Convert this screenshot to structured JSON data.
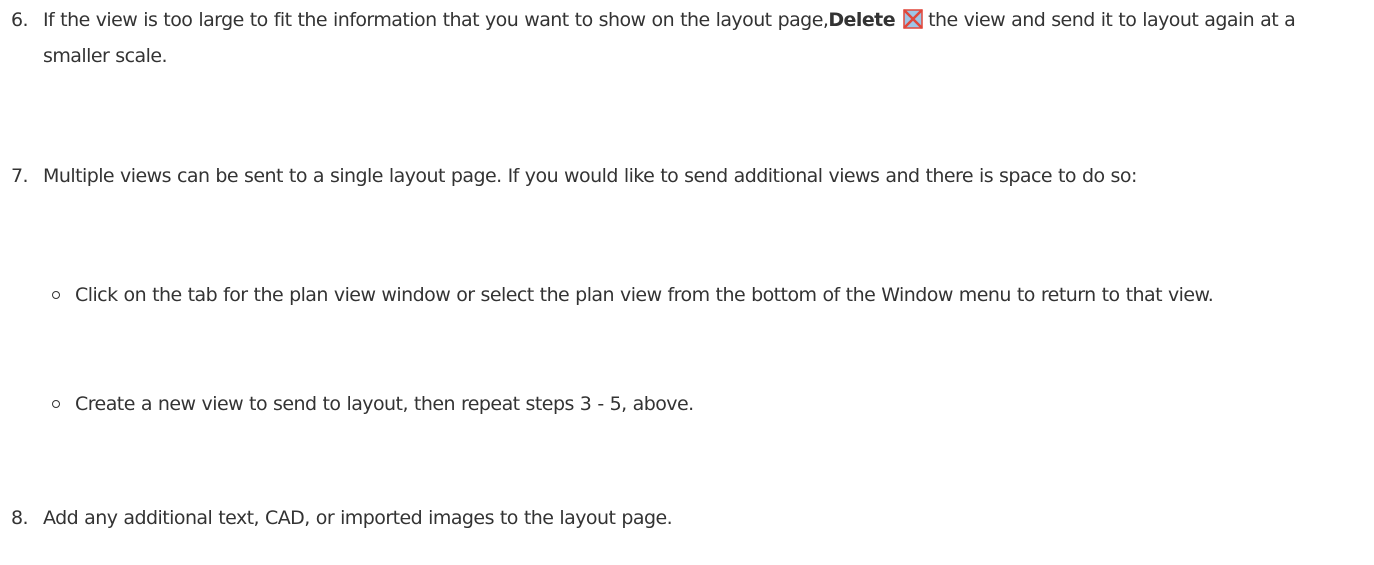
{
  "steps": [
    {
      "number": "6.",
      "text_before": "If the view is too large to fit the information that you want to show on the layout page,",
      "bold_text": "Delete",
      "icon": "delete-view-icon",
      "text_after": "the view and send it to layout again at a smaller scale."
    },
    {
      "number": "7.",
      "text": "Multiple views can be sent to a single layout page. If you would like to send additional views and there is space to do so:",
      "sub_items": [
        {
          "text": "Click on the tab for the plan view window or select the plan view from the bottom of the Window menu to return to that view."
        },
        {
          "text": "Create a new view to send to layout, then repeat steps 3 - 5, above."
        }
      ]
    },
    {
      "number": "8.",
      "text": "Add any additional text, CAD, or imported images to the layout page."
    }
  ],
  "colors": {
    "text": "#333333",
    "icon_red": "#e0463a",
    "icon_blue": "#9ec5e6"
  }
}
